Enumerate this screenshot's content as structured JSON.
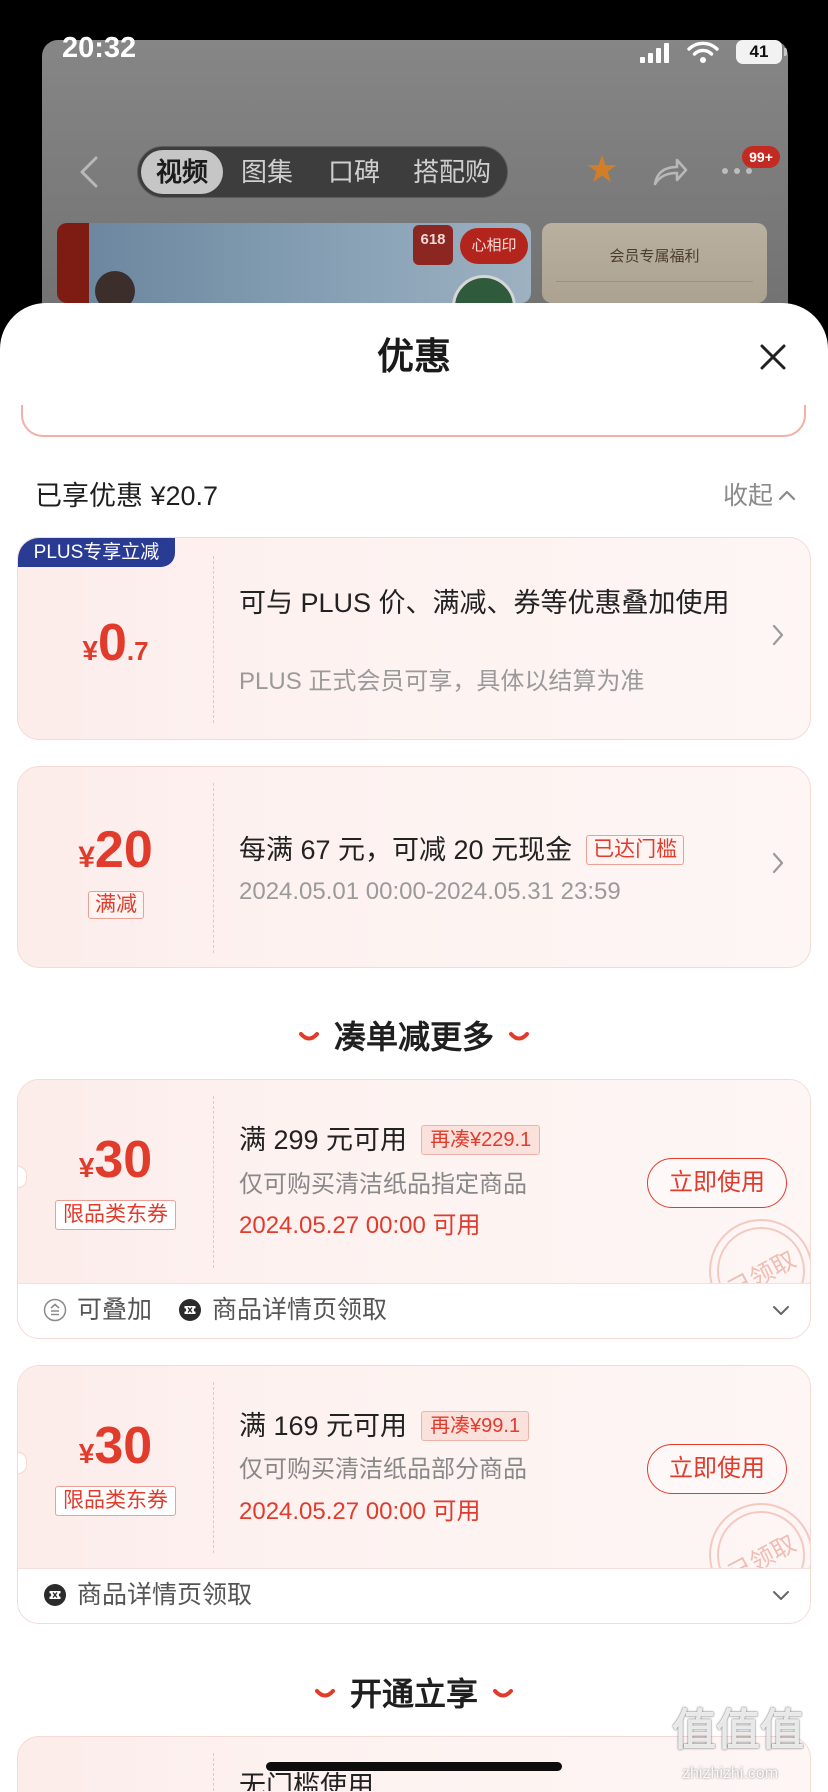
{
  "theme": {
    "accent": "#e13b2c",
    "plus_badge": "#2a3b94"
  },
  "status_bar": {
    "time": "20:32",
    "battery": "41",
    "icons": [
      "signal-icon",
      "wifi-icon",
      "battery-icon"
    ]
  },
  "background_page": {
    "tabs": [
      {
        "label": "视频",
        "selected": true
      },
      {
        "label": "图集",
        "selected": false
      },
      {
        "label": "口碑",
        "selected": false
      },
      {
        "label": "搭配购",
        "selected": false
      }
    ],
    "icons": [
      "back-icon",
      "star-icon",
      "share-icon",
      "more-icon"
    ],
    "more_badge": "99+",
    "banner": {
      "badge": "618",
      "brand": "心相印",
      "member_title": "会员专属福利"
    }
  },
  "sheet": {
    "title": "优惠",
    "summary": {
      "label": "已享优惠 ¥20.7",
      "collapse": "收起"
    },
    "discounts": [
      {
        "badge": "PLUS专享立减",
        "currency": "¥",
        "amount_int": "0",
        "amount_dec": ".7",
        "title": "可与 PLUS 价、满减、券等优惠叠加使用",
        "subtitle": "PLUS 正式会员可享，具体以结算为准"
      },
      {
        "currency": "¥",
        "amount": "20",
        "type_tag": "满减",
        "title": "每满 67 元，可减 20 元现金",
        "status_tag": "已达门槛",
        "validity": "2024.05.01 00:00-2024.05.31 23:59"
      }
    ],
    "section_titles": [
      "凑单减更多",
      "开通立享"
    ],
    "coupons": [
      {
        "currency": "¥",
        "amount": "30",
        "type_tag": "限品类东券",
        "condition": "满 299 元可用",
        "gap_tag": "再凑¥229.1",
        "scope": "仅可购买清洁纸品指定商品",
        "valid_from": "2024.05.27 00:00 可用",
        "action": "立即使用",
        "stamp": "已领取",
        "footer": [
          {
            "icon": "stackable-icon",
            "label": "可叠加"
          },
          {
            "icon": "ticket-icon",
            "label": "商品详情页领取"
          }
        ]
      },
      {
        "currency": "¥",
        "amount": "30",
        "type_tag": "限品类东券",
        "condition": "满 169 元可用",
        "gap_tag": "再凑¥99.1",
        "scope": "仅可购买清洁纸品部分商品",
        "valid_from": "2024.05.27 00:00 可用",
        "action": "立即使用",
        "stamp": "已领取",
        "footer": [
          {
            "icon": "ticket-icon",
            "label": "商品详情页领取"
          }
        ]
      }
    ],
    "partial_card": {
      "title": "无门槛使用"
    }
  },
  "watermark": {
    "logo": "值值值",
    "url": "zhizhizhi.com"
  }
}
